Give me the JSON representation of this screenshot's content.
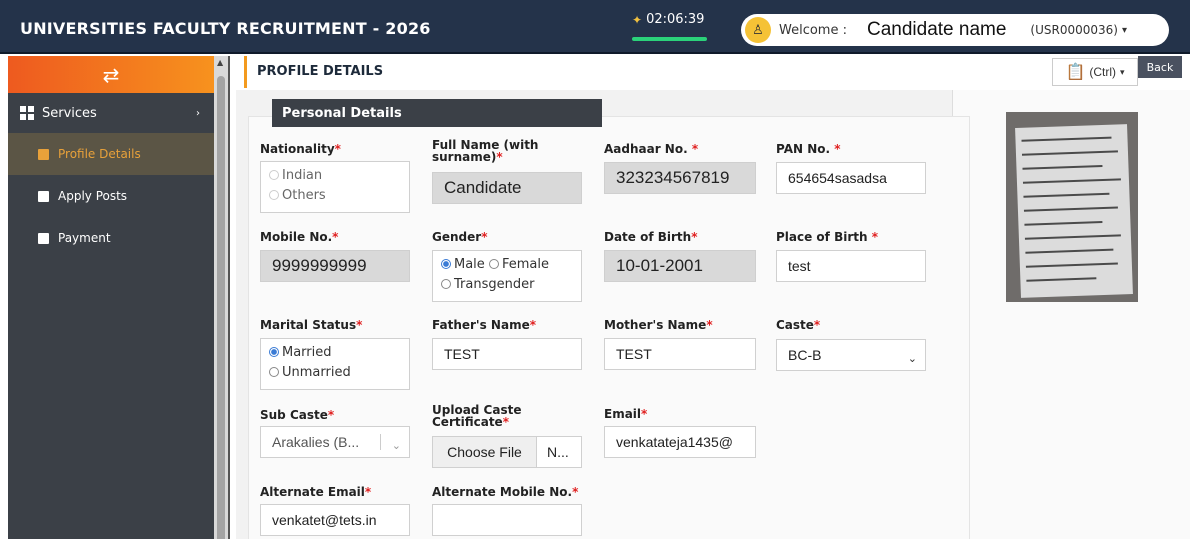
{
  "header": {
    "title": "UNIVERSITIES FACULTY RECRUITMENT - 2026",
    "timer": "02:06:39",
    "welcome_label": "Welcome :",
    "candidate_name": "Candidate name",
    "user_id": "(USR0000036)",
    "accent_color": "#f7921e"
  },
  "sidebar": {
    "services_label": "Services",
    "items": [
      {
        "label": "Profile Details",
        "active": true
      },
      {
        "label": "Apply Posts",
        "active": false
      },
      {
        "label": "Payment",
        "active": false
      }
    ]
  },
  "page": {
    "title": "PROFILE DETAILS",
    "ctrl_label": "(Ctrl)",
    "back_label": "Back",
    "section_title": "Personal Details"
  },
  "form": {
    "nationality": {
      "label": "Nationality",
      "options": [
        "Indian",
        "Others"
      ]
    },
    "full_name": {
      "label": "Full Name (with surname)",
      "value": "Candidate"
    },
    "aadhaar": {
      "label": "Aadhaar No.",
      "value": "323234567819"
    },
    "pan": {
      "label": "PAN No.",
      "value": "654654sasadsa"
    },
    "mobile": {
      "label": "Mobile No.",
      "value": "9999999999"
    },
    "gender": {
      "label": "Gender",
      "options": [
        "Male",
        "Female",
        "Transgender"
      ],
      "selected": "Male"
    },
    "dob": {
      "label": "Date of Birth",
      "value": "10-01-2001"
    },
    "place_of_birth": {
      "label": "Place of Birth",
      "value": "test"
    },
    "marital_status": {
      "label": "Marital Status",
      "options": [
        "Married",
        "Unmarried"
      ],
      "selected": "Married"
    },
    "father_name": {
      "label": "Father's Name",
      "value": "TEST"
    },
    "mother_name": {
      "label": "Mother's Name",
      "value": "TEST"
    },
    "caste": {
      "label": "Caste",
      "value": "BC-B"
    },
    "sub_caste": {
      "label": "Sub Caste",
      "value": "Arakalies (B..."
    },
    "caste_certificate": {
      "label": "Upload Caste Certificate",
      "button": "Choose File",
      "file_name": "N..."
    },
    "email": {
      "label": "Email",
      "value": "venkatateja1435@"
    },
    "alt_email": {
      "label": "Alternate Email",
      "value": "venkatet@tets.in"
    },
    "alt_mobile": {
      "label": "Alternate Mobile No.",
      "value": ""
    }
  }
}
